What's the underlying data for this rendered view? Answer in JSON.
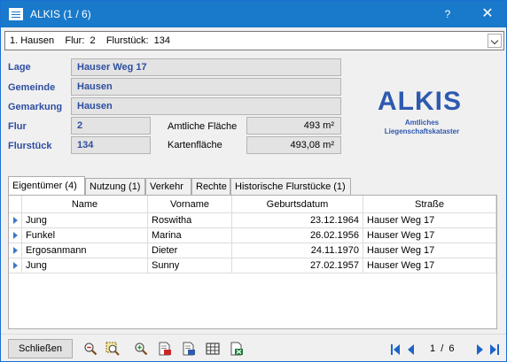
{
  "window": {
    "title": "ALKIS  (1 / 6)",
    "help": "?",
    "close": "✕"
  },
  "parcel_select": {
    "value": "1. Hausen    Flur:  2    Flurstück:  134"
  },
  "fields": {
    "lage_label": "Lage",
    "lage_value": "Hauser Weg 17",
    "gemeinde_label": "Gemeinde",
    "gemeinde_value": "Hausen",
    "gemarkung_label": "Gemarkung",
    "gemarkung_value": "Hausen",
    "flur_label": "Flur",
    "flur_value": "2",
    "flurstueck_label": "Flurstück",
    "flurstueck_value": "134",
    "amtliche_flaeche_label": "Amtliche Fläche",
    "amtliche_flaeche_value": "493 m²",
    "kartenflaeche_label": "Kartenfläche",
    "kartenflaeche_value": "493,08 m²"
  },
  "logo": {
    "title": "ALKIS",
    "subtitle_line1": "Amtliches",
    "subtitle_line2": "Liegenschaftskataster"
  },
  "tabs": [
    {
      "label": "Eigentümer (4)",
      "active": true
    },
    {
      "label": "Nutzung (1)"
    },
    {
      "label": "Verkehr"
    },
    {
      "label": "Rechte"
    },
    {
      "label": "Historische Flurstücke (1)"
    }
  ],
  "table": {
    "columns": [
      "Name",
      "Vorname",
      "Geburtsdatum",
      "Straße"
    ],
    "rows": [
      [
        "Jung",
        "Roswitha",
        "23.12.1964",
        "Hauser Weg 17"
      ],
      [
        "Funkel",
        "Marina",
        "26.02.1956",
        "Hauser Weg 17"
      ],
      [
        "Ergosanmann",
        "Dieter",
        "24.11.1970",
        "Hauser Weg 17"
      ],
      [
        "Jung",
        "Sunny",
        "27.02.1957",
        "Hauser Weg 17"
      ]
    ]
  },
  "footer": {
    "close_label": "Schließen",
    "tools": [
      "zoom-out-icon",
      "zoom-to-parcel-icon",
      "zoom-in-icon",
      "pdf-report-icon",
      "report-icon",
      "table-icon",
      "excel-export-icon"
    ],
    "pager": "1  /  6"
  },
  "colors": {
    "titlebar": "#1979ca",
    "label_blue": "#2e4ea0",
    "logo_blue": "#2e59b0",
    "nav_blue": "#1e64c8"
  }
}
